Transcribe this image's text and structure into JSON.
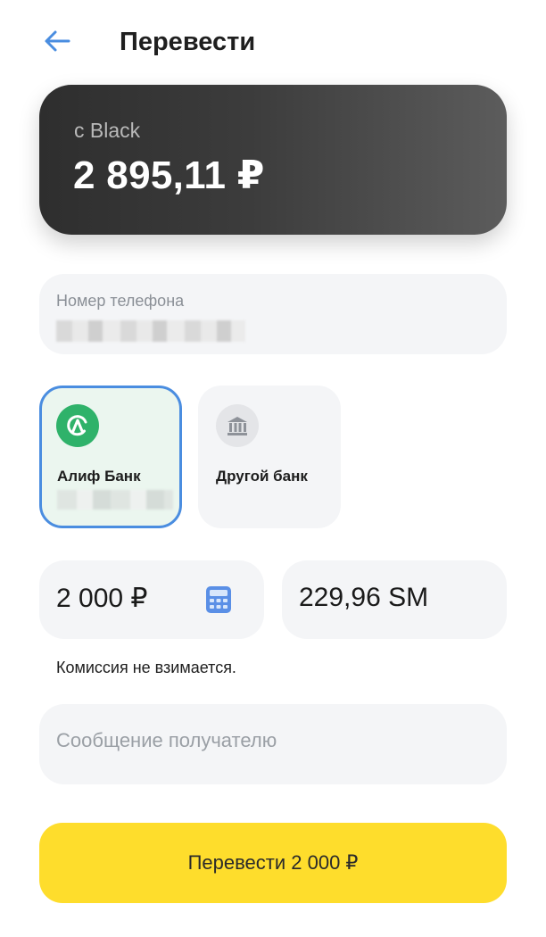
{
  "header": {
    "title": "Перевести",
    "back_icon": "arrow-left-icon"
  },
  "account": {
    "name": "с Black",
    "balance": "2 895,11 ₽"
  },
  "phone": {
    "label": "Номер телефона"
  },
  "banks": [
    {
      "name": "Алиф Банк",
      "icon": "alif-bank-logo-icon",
      "selected": true
    },
    {
      "name": "Другой банк",
      "icon": "bank-building-icon",
      "selected": false
    }
  ],
  "amount": {
    "value": "2 000 ₽",
    "calculator_icon": "calculator-icon"
  },
  "converted": {
    "value": "229,96 SM"
  },
  "commission": "Комиссия не взимается.",
  "message": {
    "placeholder": "Сообщение получателю",
    "value": ""
  },
  "submit": {
    "label": "Перевести 2 000 ₽"
  },
  "colors": {
    "accent": "#4A8DE0",
    "submit": "#FEDD2C",
    "alif_green": "#2FB26A",
    "card_dark": "#2E2E2E"
  }
}
